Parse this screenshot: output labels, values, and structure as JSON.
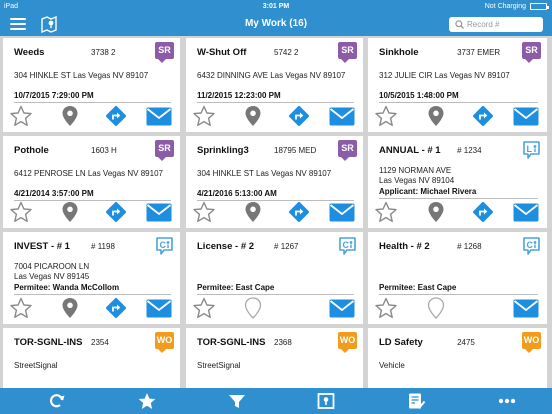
{
  "status": {
    "device": "iPad",
    "time": "3:01 PM",
    "charge": "Not Charging"
  },
  "nav": {
    "title": "My Work (16)",
    "search_placeholder": "Record #"
  },
  "colors": {
    "bar": "#2f8fcf",
    "sr": "#8c5ca8",
    "wo": "#f39b1c",
    "li": "#4aa3df",
    "action_blue": "#1e8ee0",
    "icon_gray": "#777777"
  },
  "cards": [
    {
      "title": "Weeds",
      "number": "3738 2",
      "badge": "SR",
      "lines": [
        "304 HINKLE ST Las Vegas NV 89107"
      ],
      "date": "10/7/2015 7:29:00 PM"
    },
    {
      "title": "W-Shut Off",
      "number": "5742 2",
      "badge": "SR",
      "lines": [
        "6432 DINNING AVE Las Vegas NV 89107"
      ],
      "date": "11/2/2015 12:23:00 PM"
    },
    {
      "title": "Sinkhole",
      "number": "3737 EMER",
      "badge": "SR",
      "lines": [
        "312 JULIE CIR Las Vegas NV 89107"
      ],
      "date": "10/5/2015 1:48:00 PM"
    },
    {
      "title": "Pothole",
      "number": "1603 H",
      "badge": "SR",
      "lines": [
        "6412 PENROSE LN Las Vegas NV 89107"
      ],
      "date": "4/21/2014 3:57:00 PM"
    },
    {
      "title": "Sprinkling3",
      "number": "18795 MED",
      "badge": "SR",
      "lines": [
        "304 HINKLE ST Las Vegas NV 89107"
      ],
      "date": "4/21/2016 5:13:00 AM"
    },
    {
      "title": "ANNUAL - # 1",
      "number": "# 1234",
      "badge": "LI",
      "lines": [
        "1129 NORMAN AVE",
        "Las Vegas NV 89104"
      ],
      "date": "Applicant: Michael Rivera"
    },
    {
      "title": "INVEST - # 1",
      "number": "# 1198",
      "badge": "CI",
      "lines": [
        "7004 PICAROON LN",
        "Las Vegas NV 89145"
      ],
      "date": "Permitee: Wanda McCollom"
    },
    {
      "title": "License - # 2",
      "number": "# 1267",
      "badge": "CI",
      "lines": [],
      "date": "Permitee:  East Cape"
    },
    {
      "title": "Health - # 2",
      "number": "# 1268",
      "badge": "CI",
      "lines": [],
      "date": "Permitee:  East Cape"
    },
    {
      "title": "TOR-SGNL-INS",
      "number": "2354",
      "badge": "WO",
      "lines": [
        "StreetSignal"
      ],
      "date": ""
    },
    {
      "title": "TOR-SGNL-INS",
      "number": "2368",
      "badge": "WO",
      "lines": [
        "StreetSignal"
      ],
      "date": ""
    },
    {
      "title": "LD Safety",
      "number": "2475",
      "badge": "WO",
      "lines": [
        "Vehicle"
      ],
      "date": ""
    }
  ],
  "tabs": [
    {
      "icon": "refresh-icon"
    },
    {
      "icon": "star-icon"
    },
    {
      "icon": "filter-icon"
    },
    {
      "icon": "map-icon"
    },
    {
      "icon": "checklist-icon"
    },
    {
      "icon": "more-icon"
    }
  ]
}
